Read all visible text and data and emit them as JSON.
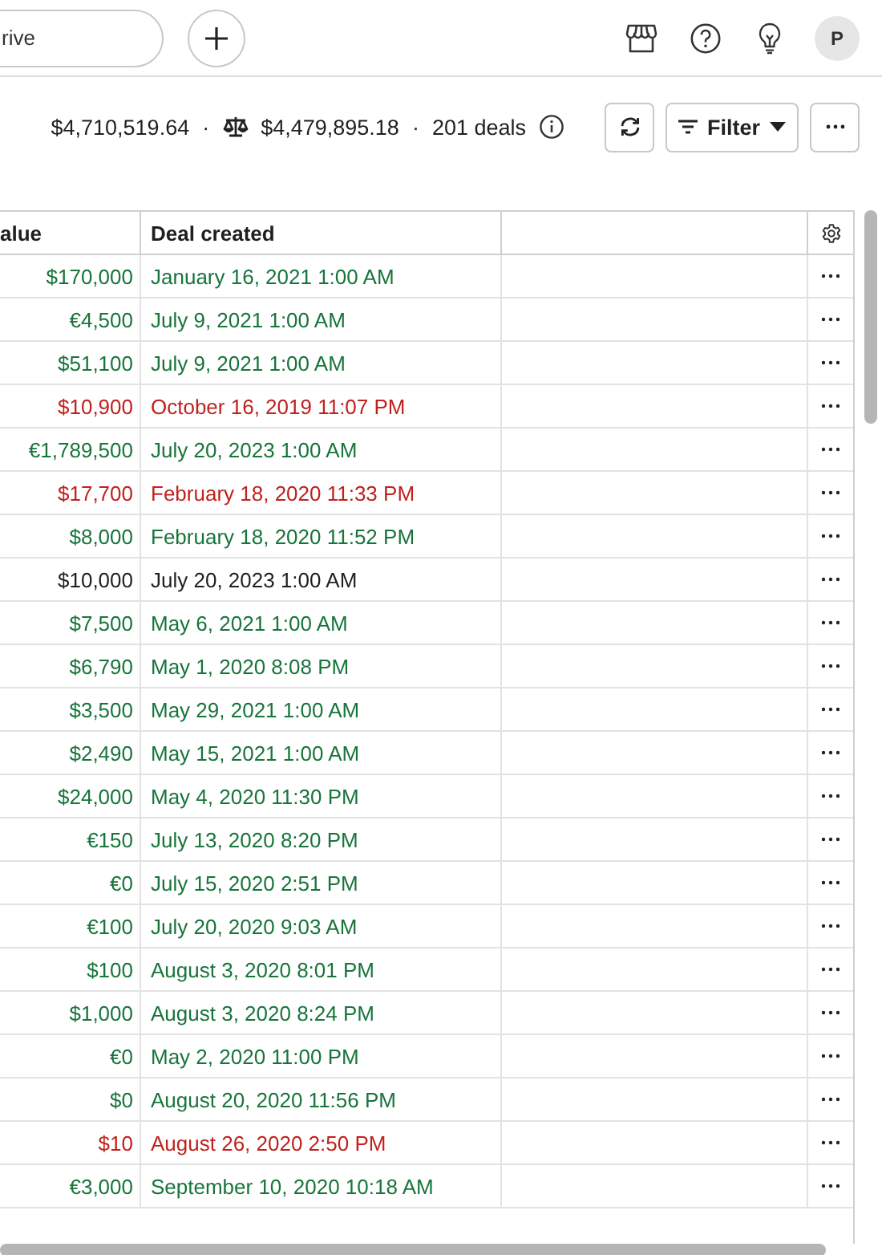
{
  "search": {
    "value": "rive"
  },
  "avatar": {
    "initial": "P"
  },
  "summary": [
    {
      "kind": "amount",
      "text": "$4,710,519.64"
    },
    {
      "kind": "separator",
      "text": "·"
    },
    {
      "kind": "weighted",
      "text": "$4,479,895.18"
    },
    {
      "kind": "separator",
      "text": "·"
    },
    {
      "kind": "amount",
      "text": "201 deals"
    }
  ],
  "toolbar": {
    "filter_label": "Filter"
  },
  "table": {
    "columns": [
      "alue",
      "Deal created"
    ],
    "rows": [
      {
        "value": "$170,000",
        "created": "January 16, 2021 1:00 AM",
        "color": "#17753a"
      },
      {
        "value": "€4,500",
        "created": "July 9, 2021 1:00 AM",
        "color": "#17753a"
      },
      {
        "value": "$51,100",
        "created": "July 9, 2021 1:00 AM",
        "color": "#17753a"
      },
      {
        "value": "$10,900",
        "created": "October 16, 2019 11:07 PM",
        "color": "#c0211d"
      },
      {
        "value": "€1,789,500",
        "created": "July 20, 2023 1:00 AM",
        "color": "#17753a"
      },
      {
        "value": "$17,700",
        "created": "February 18, 2020 11:33 PM",
        "color": "#c0211d"
      },
      {
        "value": "$8,000",
        "created": "February 18, 2020 11:52 PM",
        "color": "#17753a"
      },
      {
        "value": "$10,000",
        "created": "July 20, 2023 1:00 AM",
        "color": "#1f1f1f"
      },
      {
        "value": "$7,500",
        "created": "May 6, 2021 1:00 AM",
        "color": "#17753a"
      },
      {
        "value": "$6,790",
        "created": "May 1, 2020 8:08 PM",
        "color": "#17753a"
      },
      {
        "value": "$3,500",
        "created": "May 29, 2021 1:00 AM",
        "color": "#17753a"
      },
      {
        "value": "$2,490",
        "created": "May 15, 2021 1:00 AM",
        "color": "#17753a"
      },
      {
        "value": "$24,000",
        "created": "May 4, 2020 11:30 PM",
        "color": "#17753a"
      },
      {
        "value": "€150",
        "created": "July 13, 2020 8:20 PM",
        "color": "#17753a"
      },
      {
        "value": "€0",
        "created": "July 15, 2020 2:51 PM",
        "color": "#17753a"
      },
      {
        "value": "€100",
        "created": "July 20, 2020 9:03 AM",
        "color": "#17753a"
      },
      {
        "value": "$100",
        "created": "August 3, 2020 8:01 PM",
        "color": "#17753a"
      },
      {
        "value": "$1,000",
        "created": "August 3, 2020 8:24 PM",
        "color": "#17753a"
      },
      {
        "value": "€0",
        "created": "May 2, 2020 11:00 PM",
        "color": "#17753a"
      },
      {
        "value": "$0",
        "created": "August 20, 2020 11:56 PM",
        "color": "#17753a"
      },
      {
        "value": "$10",
        "created": "August 26, 2020 2:50 PM",
        "color": "#c0211d"
      },
      {
        "value": "€3,000",
        "created": "September 10, 2020 10:18 AM",
        "color": "#17753a"
      }
    ]
  }
}
